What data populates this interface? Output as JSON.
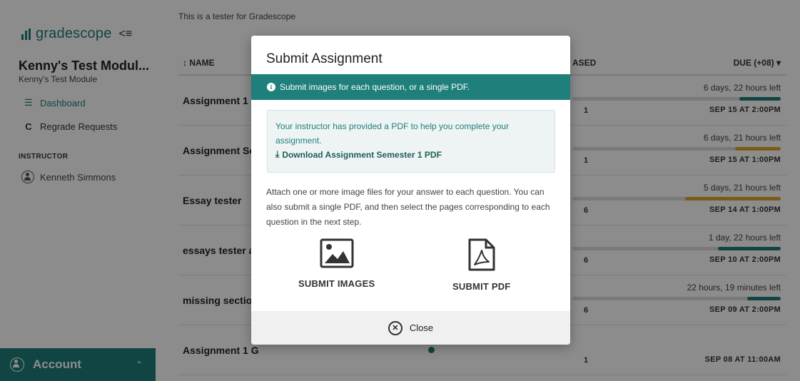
{
  "sidebar": {
    "logo_text": "gradescope",
    "collapse_glyph": "<≡",
    "course_title": "Kenny's Test Modul...",
    "course_subtitle": "Kenny's Test Module",
    "nav": {
      "dashboard": "Dashboard",
      "regrade": "Regrade Requests"
    },
    "instructor_label": "INSTRUCTOR",
    "instructor_name": "Kenneth Simmons",
    "account_label": "Account",
    "accent_color": "#1f7f7b"
  },
  "main": {
    "tester_note": "This is a tester for Gradescope",
    "table": {
      "headers": {
        "name": "↕ NAME",
        "released": "ASED",
        "due": "DUE (+08) ▾"
      },
      "rows": [
        {
          "name": "Assignment 1 G",
          "released": "1",
          "time_left": "6 days, 22 hours left",
          "progress": 0.2,
          "color": "#1f7f7b",
          "due": "SEP 15 AT 2:00PM"
        },
        {
          "name": "Assignment Se",
          "released": "1",
          "time_left": "6 days, 21 hours left",
          "progress": 0.22,
          "color": "#e1a827",
          "due": "SEP 15 AT 1:00PM"
        },
        {
          "name": "Essay tester",
          "released": "6",
          "time_left": "5 days, 21 hours left",
          "progress": 0.46,
          "color": "#e1a827",
          "due": "SEP 14 AT 1:00PM"
        },
        {
          "name": "essays tester a",
          "released": "6",
          "time_left": "1 day, 22 hours left",
          "progress": 0.3,
          "color": "#1f7f7b",
          "due": "SEP 10 AT 2:00PM"
        },
        {
          "name": "missing section",
          "released": "6",
          "time_left": "22 hours, 19 minutes left",
          "progress": 0.16,
          "color": "#1f7f7b",
          "due": "SEP 09 AT 2:00PM"
        },
        {
          "name": "Assignment 1 G",
          "released": "1",
          "time_left": "",
          "progress": null,
          "color": "#1f7f7b",
          "due": "SEP 08 AT 11:00AM"
        }
      ]
    }
  },
  "modal": {
    "title": "Submit Assignment",
    "info_banner": "Submit images for each question, or a single PDF.",
    "pdf_notice": "Your instructor has provided a PDF to help you complete your assignment.",
    "pdf_download_label": "Download Assignment Semester 1 PDF",
    "instructions": "Attach one or more image files for your answer to each question. You can also submit a single PDF, and then select the pages corresponding to each question in the next step.",
    "submit_images_label": "SUBMIT IMAGES",
    "submit_pdf_label": "SUBMIT PDF",
    "close_label": "Close",
    "icons": {
      "info": "info-icon",
      "download": "download-icon",
      "images": "image-icon",
      "pdf": "pdf-file-icon",
      "close": "close-circle-icon"
    }
  }
}
